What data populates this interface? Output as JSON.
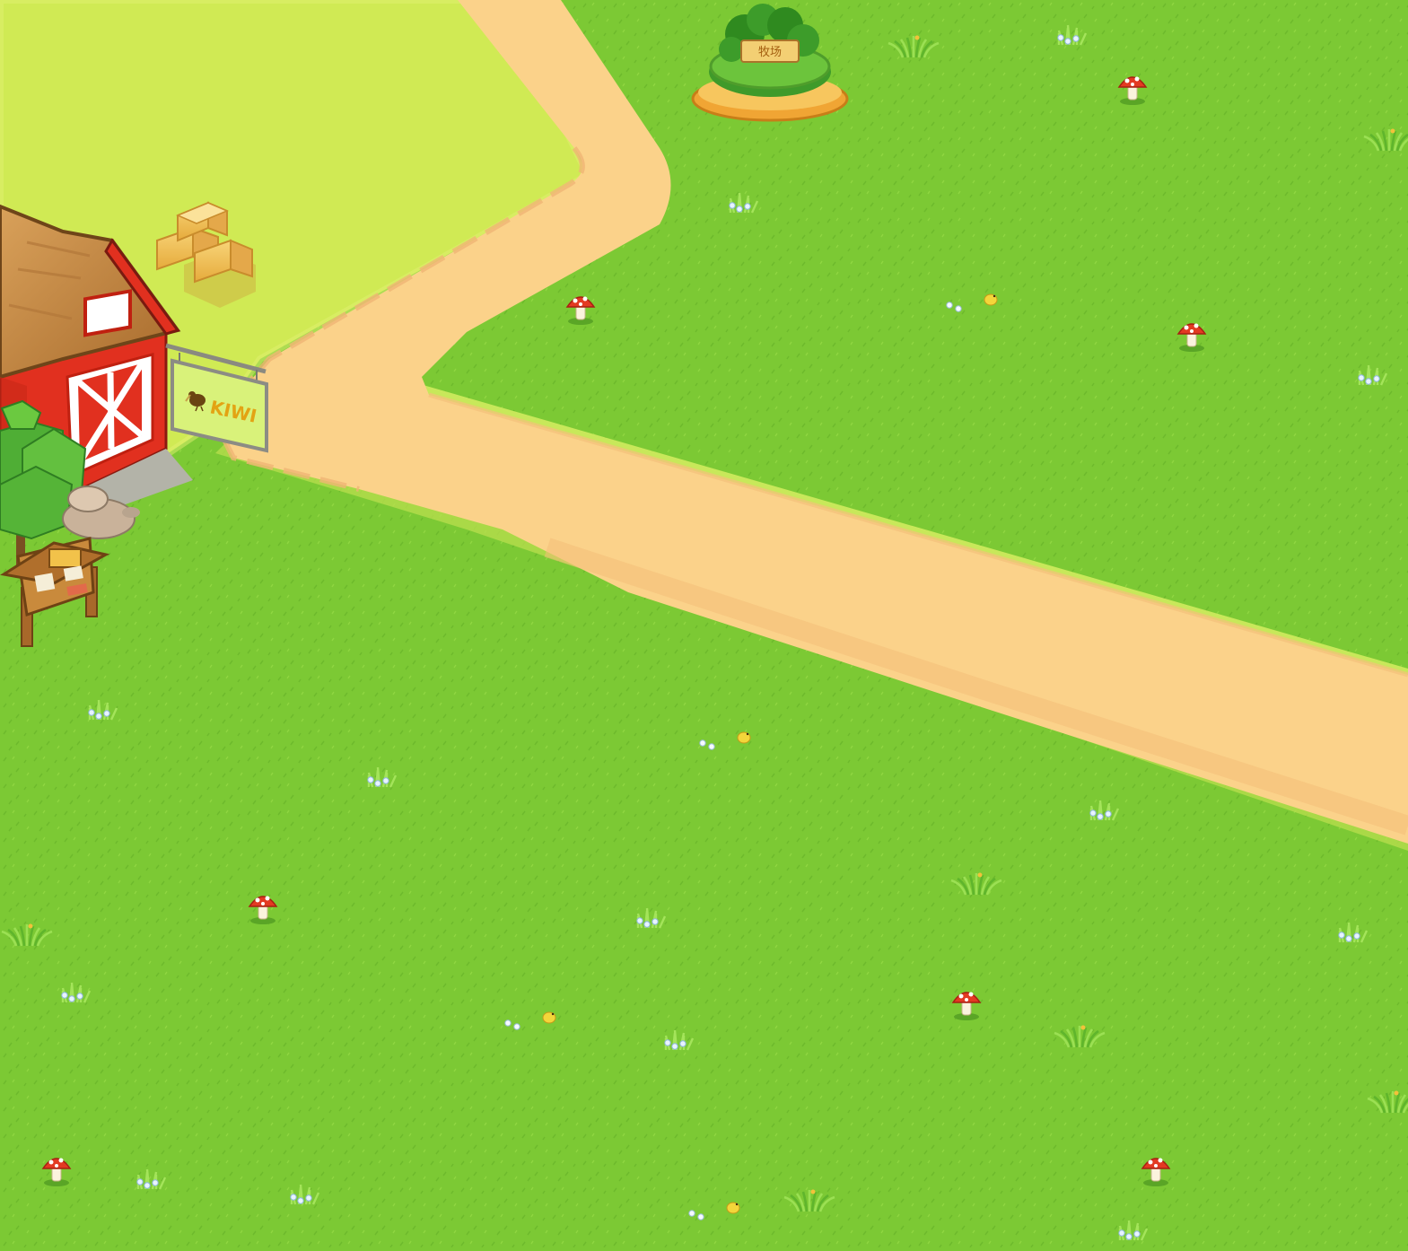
{
  "colors": {
    "grass": "#7cc934",
    "grass_dark": "#6fbd2b",
    "meadow": "#d0ea54",
    "path": "#fbd28a",
    "path_edge": "#f0b574",
    "barn_red": "#e1301f",
    "roof_wood": "#c78a44",
    "hay": "#f2c25a",
    "sign_green": "#d9f27a",
    "sign_text": "#e3a313",
    "plaque": "#f3cf73",
    "plaque_text": "#a45f10"
  },
  "farm_sign": {
    "label": "KIWI",
    "icon": "kiwi-bird-icon"
  },
  "pasture_island": {
    "label": "牧场",
    "icon": "tree-island-icon"
  }
}
